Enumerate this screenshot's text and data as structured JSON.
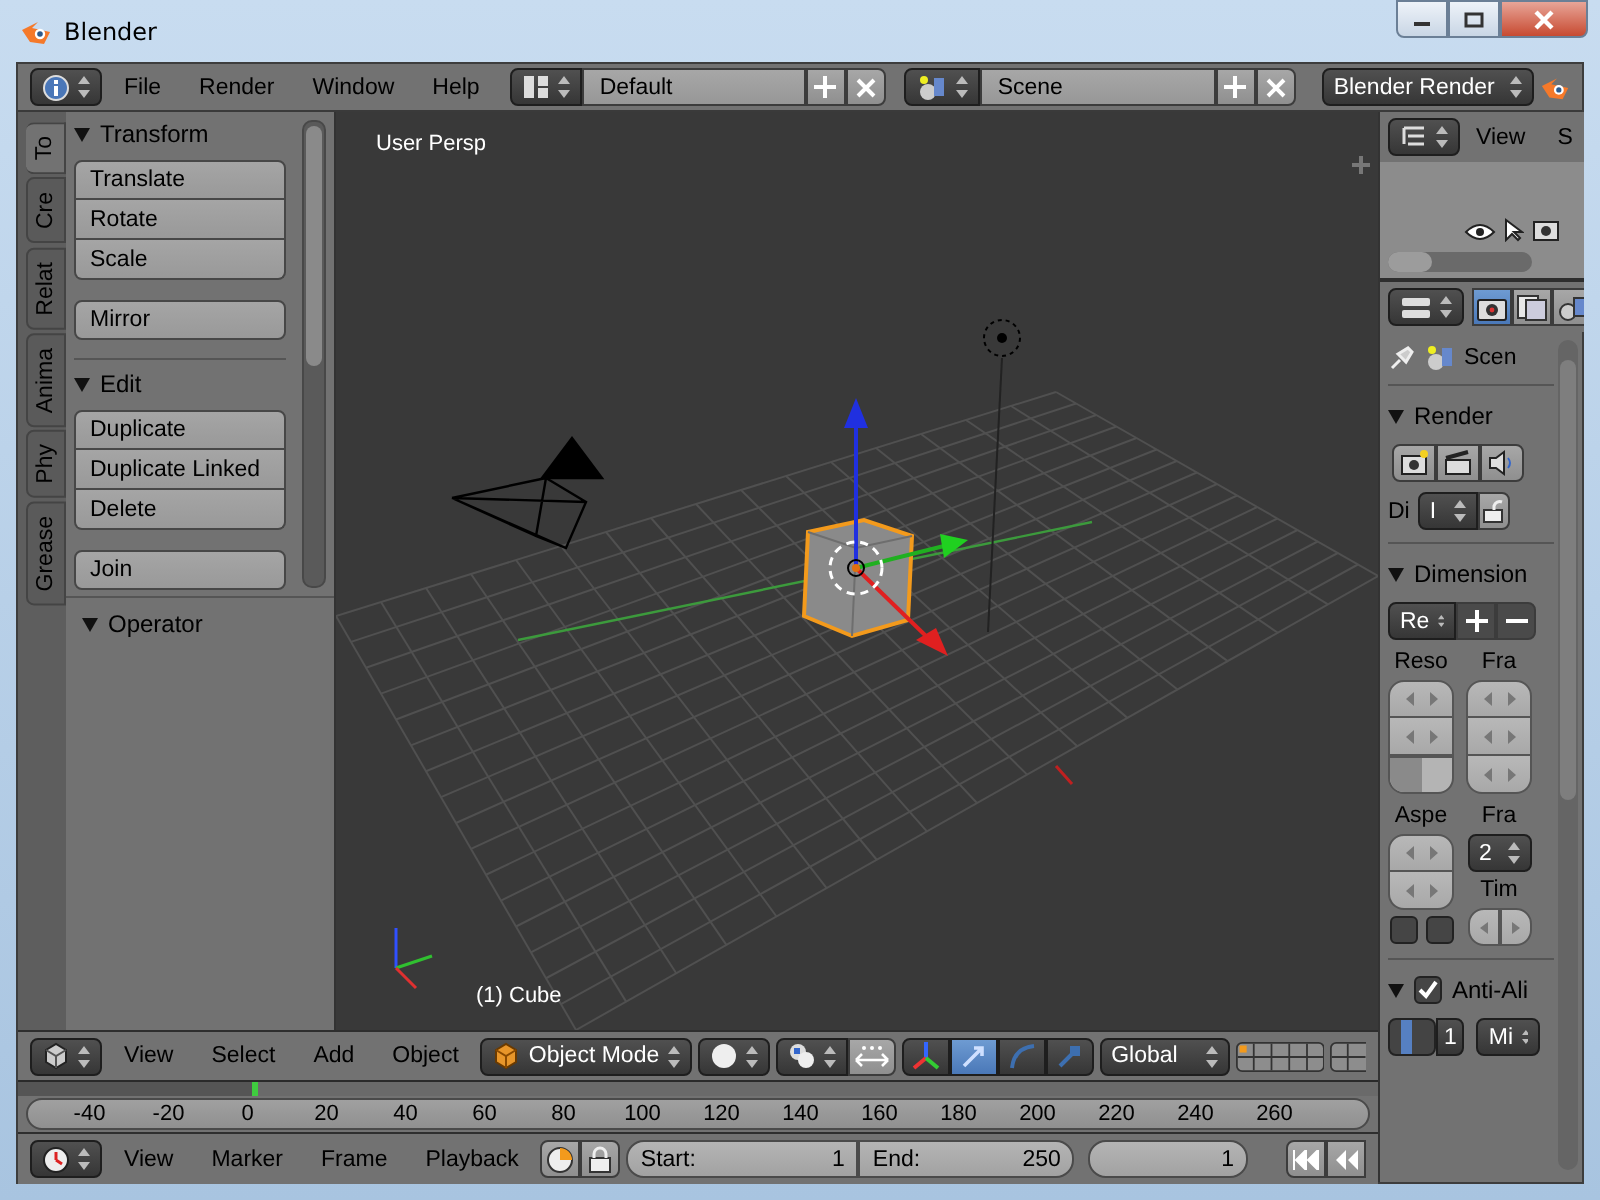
{
  "window": {
    "title": "Blender"
  },
  "info_header": {
    "menus": [
      "File",
      "Render",
      "Window",
      "Help"
    ],
    "screen_layout": "Default",
    "scene": "Scene",
    "render_engine": "Blender Render"
  },
  "tool_shelf": {
    "tabs": [
      {
        "label": "To",
        "selected": true
      },
      {
        "label": "Cre",
        "selected": false
      },
      {
        "label": "Relat",
        "selected": false
      },
      {
        "label": "Anima",
        "selected": false
      },
      {
        "label": "Phy",
        "selected": false
      },
      {
        "label": "Grease",
        "selected": false
      }
    ],
    "panels": [
      {
        "title": "Transform",
        "expanded": true,
        "button_groups": [
          [
            "Translate",
            "Rotate",
            "Scale"
          ],
          [
            "Mirror"
          ]
        ]
      },
      {
        "title": "Edit",
        "expanded": true,
        "button_groups": [
          [
            "Duplicate",
            "Duplicate Linked",
            "Delete"
          ],
          [
            "Join"
          ]
        ]
      }
    ],
    "operator_panel": {
      "title": "Operator",
      "expanded": true
    }
  },
  "viewport": {
    "view_name": "User Persp",
    "active_object": "(1) Cube"
  },
  "view3d_header": {
    "menus": [
      "View",
      "Select",
      "Add",
      "Object"
    ],
    "mode": "Object Mode",
    "manipulators": [
      {
        "kind": "translate",
        "selected": true
      },
      {
        "kind": "rotate",
        "selected": false
      },
      {
        "kind": "scale",
        "selected": false
      }
    ],
    "orientation": "Global"
  },
  "timeline": {
    "ticks": [
      "-40",
      "-20",
      "0",
      "20",
      "40",
      "60",
      "80",
      "100",
      "120",
      "140",
      "160",
      "180",
      "200",
      "220",
      "240",
      "260"
    ],
    "menus": [
      "View",
      "Marker",
      "Frame",
      "Playback"
    ],
    "start_label": "Start:",
    "start": "1",
    "end_label": "End:",
    "end": "250",
    "current_frame": "1"
  },
  "outliner": {
    "menus": [
      "View",
      "S"
    ]
  },
  "properties": {
    "context_tabs": [
      {
        "kind": "render",
        "selected": true
      },
      {
        "kind": "render_layers",
        "selected": false
      },
      {
        "kind": "scene",
        "selected": false
      }
    ],
    "scene_name": "Scen",
    "render_panel": {
      "title": "Render",
      "expanded": true,
      "display_label": "Di",
      "display_value": "I"
    },
    "dimensions_panel": {
      "title": "Dimension",
      "expanded": true,
      "preset": "Re",
      "resolution_percentage": {
        "level": 0.5
      },
      "aspect_checkboxes": [
        {
          "checked": false
        },
        {
          "checked": false
        }
      ],
      "resolution_label": "Reso",
      "frame_range_label": "Fra",
      "aspect_label": "Aspe",
      "frame_rate_label": "Fra",
      "frame_rate": "2",
      "time_remap_label": "Tim"
    },
    "anti_aliasing_panel": {
      "title": "Anti-Ali",
      "expanded": true,
      "checked": true,
      "samples": "1",
      "filter": "Mi"
    }
  }
}
